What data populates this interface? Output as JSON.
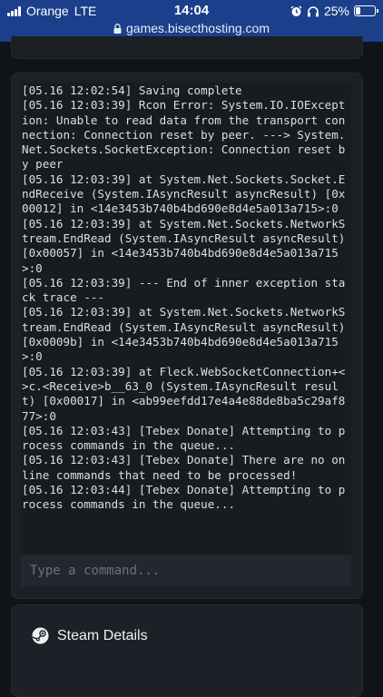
{
  "status_bar": {
    "carrier": "Orange",
    "network": "LTE",
    "time": "14:04",
    "battery_percent": "25%",
    "battery_level": 0.25,
    "icons": [
      "signal-icon",
      "alarm-icon",
      "headphones-icon",
      "battery-icon"
    ]
  },
  "browser": {
    "url": "games.bisecthosting.com",
    "lock_icon": "lock-icon"
  },
  "console": {
    "lines": [
      "[05.16 12:02:54] Saving complete",
      "[05.16 12:03:39] Rcon Error: System.IO.IOException: Unable to read data from the transport connection: Connection reset by peer. ---> System.Net.Sockets.SocketException: Connection reset by peer",
      "[05.16 12:03:39] at System.Net.Sockets.Socket.EndReceive (System.IAsyncResult asyncResult) [0x00012] in <14e3453b740b4bd690e8d4e5a013a715>:0",
      "[05.16 12:03:39] at System.Net.Sockets.NetworkStream.EndRead (System.IAsyncResult asyncResult) [0x00057] in <14e3453b740b4bd690e8d4e5a013a715>:0",
      "[05.16 12:03:39] --- End of inner exception stack trace ---",
      "[05.16 12:03:39] at System.Net.Sockets.NetworkStream.EndRead (System.IAsyncResult asyncResult) [0x0009b] in <14e3453b740b4bd690e8d4e5a013a715>:0",
      "[05.16 12:03:39] at Fleck.WebSocketConnection+<>c.<Receive>b__63_0 (System.IAsyncResult result) [0x00017] in <ab99eefdd17e4a4e88de8ba5c29af877>:0",
      "[05.16 12:03:43] [Tebex Donate] Attempting to process commands in the queue...",
      "[05.16 12:03:43] [Tebex Donate] There are no online commands that need to be processed!",
      "[05.16 12:03:44] [Tebex Donate] Attempting to process commands in the queue..."
    ],
    "command_input": {
      "value": "",
      "placeholder": "Type a command..."
    }
  },
  "steam_details": {
    "title": "Steam Details",
    "icon": "steam-icon"
  },
  "colors": {
    "status_bar_bg": "#1b3f8a",
    "page_bg": "#101418",
    "panel_bg": "#1c2127",
    "console_bg": "#181c21",
    "console_text": "#dcdfe3"
  }
}
